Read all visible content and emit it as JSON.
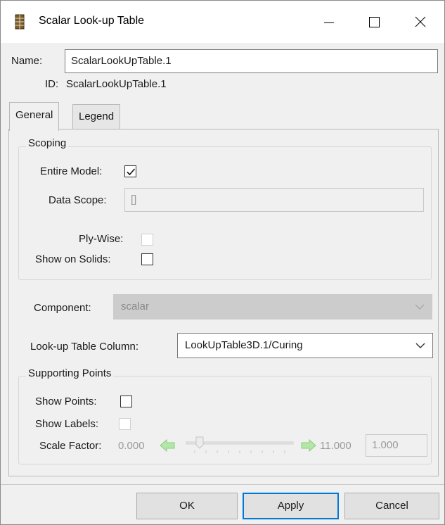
{
  "window": {
    "title": "Scalar Look-up Table",
    "icon": "table-icon",
    "controls": [
      "minimize-icon",
      "maximize-icon",
      "close-icon"
    ]
  },
  "name": {
    "label": "Name:",
    "value": "ScalarLookUpTable.1"
  },
  "id": {
    "label": "ID:",
    "value": "ScalarLookUpTable.1"
  },
  "tabs": [
    {
      "label": "General",
      "active": true
    },
    {
      "label": "Legend",
      "active": false
    }
  ],
  "scoping": {
    "title": "Scoping",
    "entire_model": {
      "label": "Entire Model:",
      "checked": true
    },
    "data_scope": {
      "label": "Data Scope:",
      "value": "[]"
    },
    "ply_wise": {
      "label": "Ply-Wise:",
      "checked": false,
      "enabled": false
    },
    "show_on_solids": {
      "label": "Show on Solids:",
      "checked": false
    }
  },
  "component": {
    "label": "Component:",
    "value": "scalar",
    "enabled": false
  },
  "lookup_column": {
    "label": "Look-up Table Column:",
    "value": "LookUpTable3D.1/Curing"
  },
  "supporting_points": {
    "title": "Supporting Points",
    "show_points": {
      "label": "Show Points:",
      "checked": false
    },
    "show_labels": {
      "label": "Show Labels:",
      "checked": false,
      "enabled": false
    },
    "scale_factor": {
      "label": "Scale Factor:",
      "min": "0.000",
      "max": "11.000",
      "value": "1.000",
      "slider_fraction": 0.1
    }
  },
  "buttons": {
    "ok": "OK",
    "apply": "Apply",
    "cancel": "Cancel"
  },
  "colors": {
    "arrow_disabled": "#a8e0a0",
    "accent": "#0078d7"
  }
}
